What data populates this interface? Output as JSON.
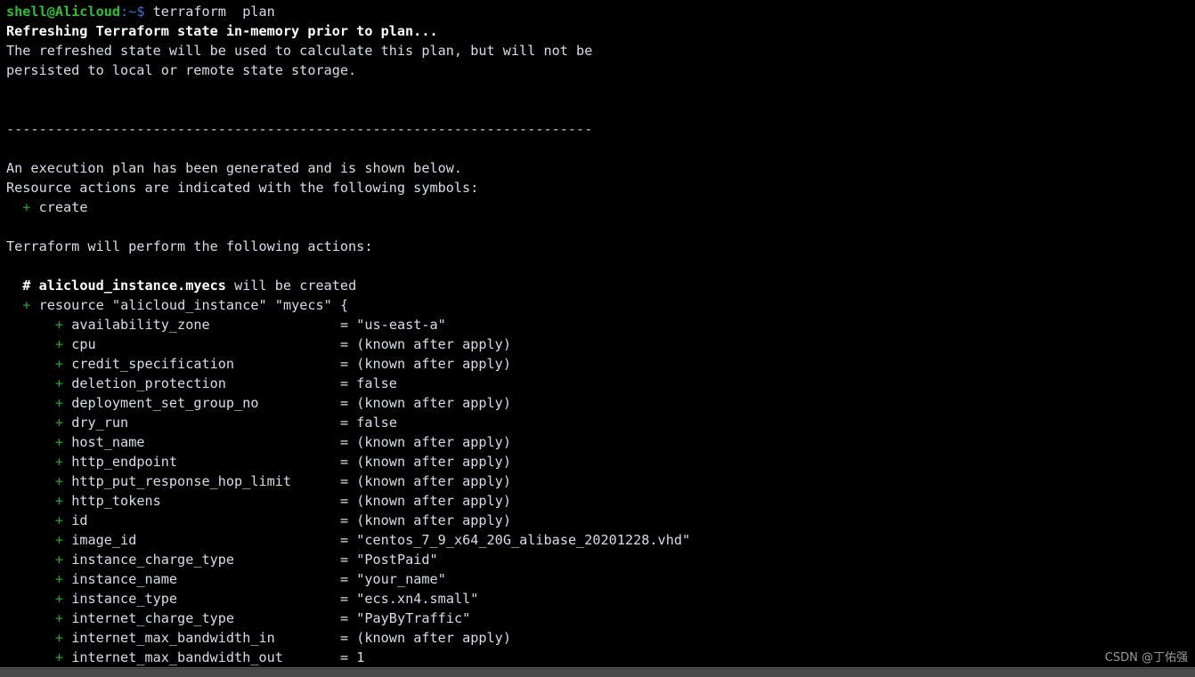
{
  "terminal": {
    "title": "terraform plan output",
    "background_color": "#000000",
    "foreground_color": "#d8dce8",
    "plus_color": "#1faa1f",
    "prompt_user_host_color": "#2fbf2f",
    "prompt_path_color": "#3a6fd8"
  },
  "prompt": {
    "user_host": "shell@Alicloud",
    "colon": ":",
    "path": "~",
    "sigil": "$",
    "command": " terraform  plan"
  },
  "output": {
    "refreshing": "Refreshing Terraform state in-memory prior to plan...",
    "note_line_1": "The refreshed state will be used to calculate this plan, but will not be",
    "note_line_2": "persisted to local or remote state storage.",
    "separator": "------------------------------------------------------------------------",
    "exec_plan_line": "An execution plan has been generated and is shown below.",
    "resource_actions_line": "Resource actions are indicated with the following symbols:",
    "symbol_create_plus": "+",
    "symbol_create_label": "create",
    "perform_actions_line": "Terraform will perform the following actions:",
    "comment_hash": "#",
    "comment_resource_address": "alicloud_instance.myecs",
    "comment_suffix": " will be created",
    "resource_keyword": "resource",
    "resource_type": "\"alicloud_instance\"",
    "resource_name": "\"myecs\"",
    "resource_brace": "{"
  },
  "attributes": [
    {
      "name": "availability_zone",
      "value": "\"us-east-a\""
    },
    {
      "name": "cpu",
      "value": "(known after apply)"
    },
    {
      "name": "credit_specification",
      "value": "(known after apply)"
    },
    {
      "name": "deletion_protection",
      "value": "false"
    },
    {
      "name": "deployment_set_group_no",
      "value": "(known after apply)"
    },
    {
      "name": "dry_run",
      "value": "false"
    },
    {
      "name": "host_name",
      "value": "(known after apply)"
    },
    {
      "name": "http_endpoint",
      "value": "(known after apply)"
    },
    {
      "name": "http_put_response_hop_limit",
      "value": "(known after apply)"
    },
    {
      "name": "http_tokens",
      "value": "(known after apply)"
    },
    {
      "name": "id",
      "value": "(known after apply)"
    },
    {
      "name": "image_id",
      "value": "\"centos_7_9_x64_20G_alibase_20201228.vhd\""
    },
    {
      "name": "instance_charge_type",
      "value": "\"PostPaid\""
    },
    {
      "name": "instance_name",
      "value": "\"your_name\""
    },
    {
      "name": "instance_type",
      "value": "\"ecs.xn4.small\""
    },
    {
      "name": "internet_charge_type",
      "value": "\"PayByTraffic\""
    },
    {
      "name": "internet_max_bandwidth_in",
      "value": "(known after apply)"
    },
    {
      "name": "internet_max_bandwidth_out",
      "value": "1"
    }
  ],
  "watermark": {
    "text": "CSDN @丁佑强"
  }
}
